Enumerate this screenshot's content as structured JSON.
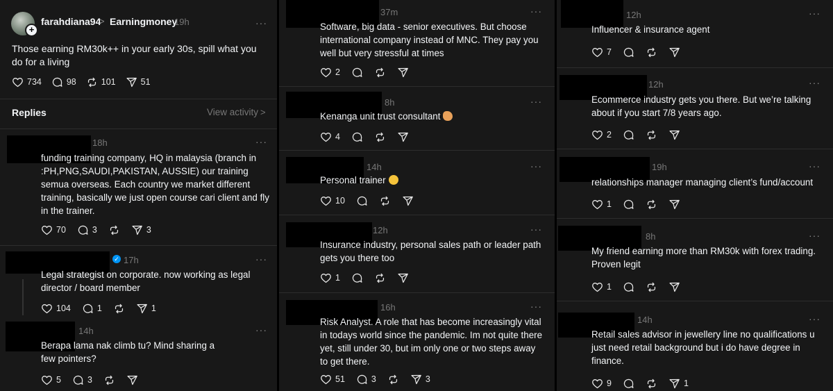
{
  "main_post": {
    "username": "farahdiana94",
    "separator": ">",
    "community": "Earningmoney",
    "time": "19h",
    "more": "···",
    "text": "Those earning RM30k++ in your early 30s, spill what you do for a living",
    "likes": "734",
    "comments": "98",
    "reposts": "101",
    "shares": "51"
  },
  "replies_header": {
    "title": "Replies",
    "view_activity": "View activity",
    "chevron": ">"
  },
  "col1_replies": [
    {
      "time": "18h",
      "text": "funding training company, HQ in malaysia (branch in :PH,PNG,SAUDI,PAKISTAN, AUSSIE) our training semua overseas. Each country we market different training, basically we just open course cari client and fly in the trainer.",
      "likes": "70",
      "comments": "3",
      "shares": "3"
    },
    {
      "time": "17h",
      "text": "Legal strategist on corporate. now working as legal director / board member",
      "likes": "104",
      "comments": "1",
      "shares": "1",
      "verified": true
    },
    {
      "time": "14h",
      "text": "Berapa lama nak climb tu? Mind sharing a few pointers?",
      "likes": "5",
      "comments": "3",
      "shares": ""
    }
  ],
  "col2_replies": [
    {
      "time": "37m",
      "text": "Software, big data - senior executives. But choose international company instead of MNC. They pay you well but very stressful at times",
      "likes": "2",
      "comments": "",
      "shares": ""
    },
    {
      "time": "8h",
      "text": "Kenanga unit trust consultant",
      "emoji": "flexed-biceps",
      "likes": "4",
      "comments": "",
      "shares": ""
    },
    {
      "time": "14h",
      "text": "Personal trainer",
      "emoji": "grinning-face",
      "likes": "10",
      "comments": "",
      "shares": ""
    },
    {
      "time": "12h",
      "text": "Insurance industry, personal sales path or leader path gets you there too",
      "likes": "1",
      "comments": "",
      "shares": ""
    },
    {
      "time": "16h",
      "text": "Risk Analyst. A role that has become increasingly vital in todays world since the pandemic. Im not quite there yet, still under 30, but im only one or two steps away to get there.",
      "likes": "51",
      "comments": "3",
      "shares": "3"
    }
  ],
  "col3_replies": [
    {
      "time": "12h",
      "text": "Influencer & insurance agent",
      "likes": "7",
      "comments": "",
      "shares": ""
    },
    {
      "time": "12h",
      "text": "Ecommerce industry gets you there. But we’re talking about if you start 7/8 years ago.",
      "likes": "2",
      "comments": "",
      "shares": ""
    },
    {
      "time": "19h",
      "text": "relationships manager managing client’s fund/account",
      "likes": "1",
      "comments": "",
      "shares": ""
    },
    {
      "time": "8h",
      "text": "My friend earning more than RM30k with forex trading. Proven legit",
      "likes": "1",
      "comments": "",
      "shares": ""
    },
    {
      "time": "14h",
      "text": "Retail sales advisor in jewellery line no qualifications u just need retail background but i do have degree in finance.",
      "likes": "9",
      "comments": "",
      "shares": "1"
    }
  ],
  "colors": {
    "background": "#181818",
    "divider": "#2d2d2d",
    "text": "#f3f5f7",
    "muted": "#777777",
    "verified": "#0095f6"
  },
  "icons": [
    "heart-icon",
    "comment-icon",
    "repost-icon",
    "share-icon",
    "more-icon",
    "verified-icon",
    "chevron-right-icon",
    "add-follow-icon"
  ]
}
